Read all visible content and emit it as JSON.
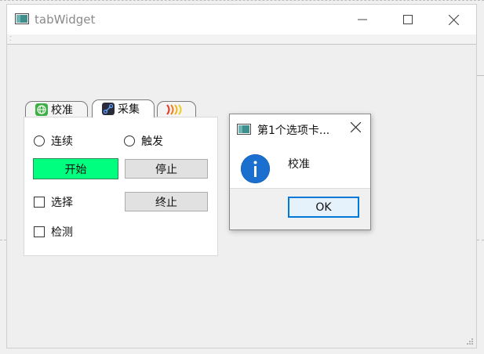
{
  "window": {
    "title": "tabWidget",
    "minimize_icon": "minimize-icon",
    "maximize_icon": "maximize-icon",
    "close_icon": "close-icon"
  },
  "tabs": [
    {
      "label": "校准",
      "icon": "globe-icon",
      "icon_color": "#3cb043"
    },
    {
      "label": "采集",
      "icon": "link-icon",
      "icon_color": "#2b2b3a"
    },
    {
      "label": "",
      "icon": "signal-bars-icon",
      "icon_color": "#e03a1e"
    }
  ],
  "panel": {
    "radio_continuous": "连续",
    "radio_trigger": "触发",
    "start_button": "开始",
    "stop_button": "停止",
    "check_select": "选择",
    "terminate_button": "终止",
    "check_detect": "检测",
    "accent_color": "#00ff7f"
  },
  "dialog": {
    "title": "第1个选项卡...",
    "message": "校准",
    "ok_label": "OK",
    "icon": "info-icon",
    "accent_color": "#0078d7"
  }
}
